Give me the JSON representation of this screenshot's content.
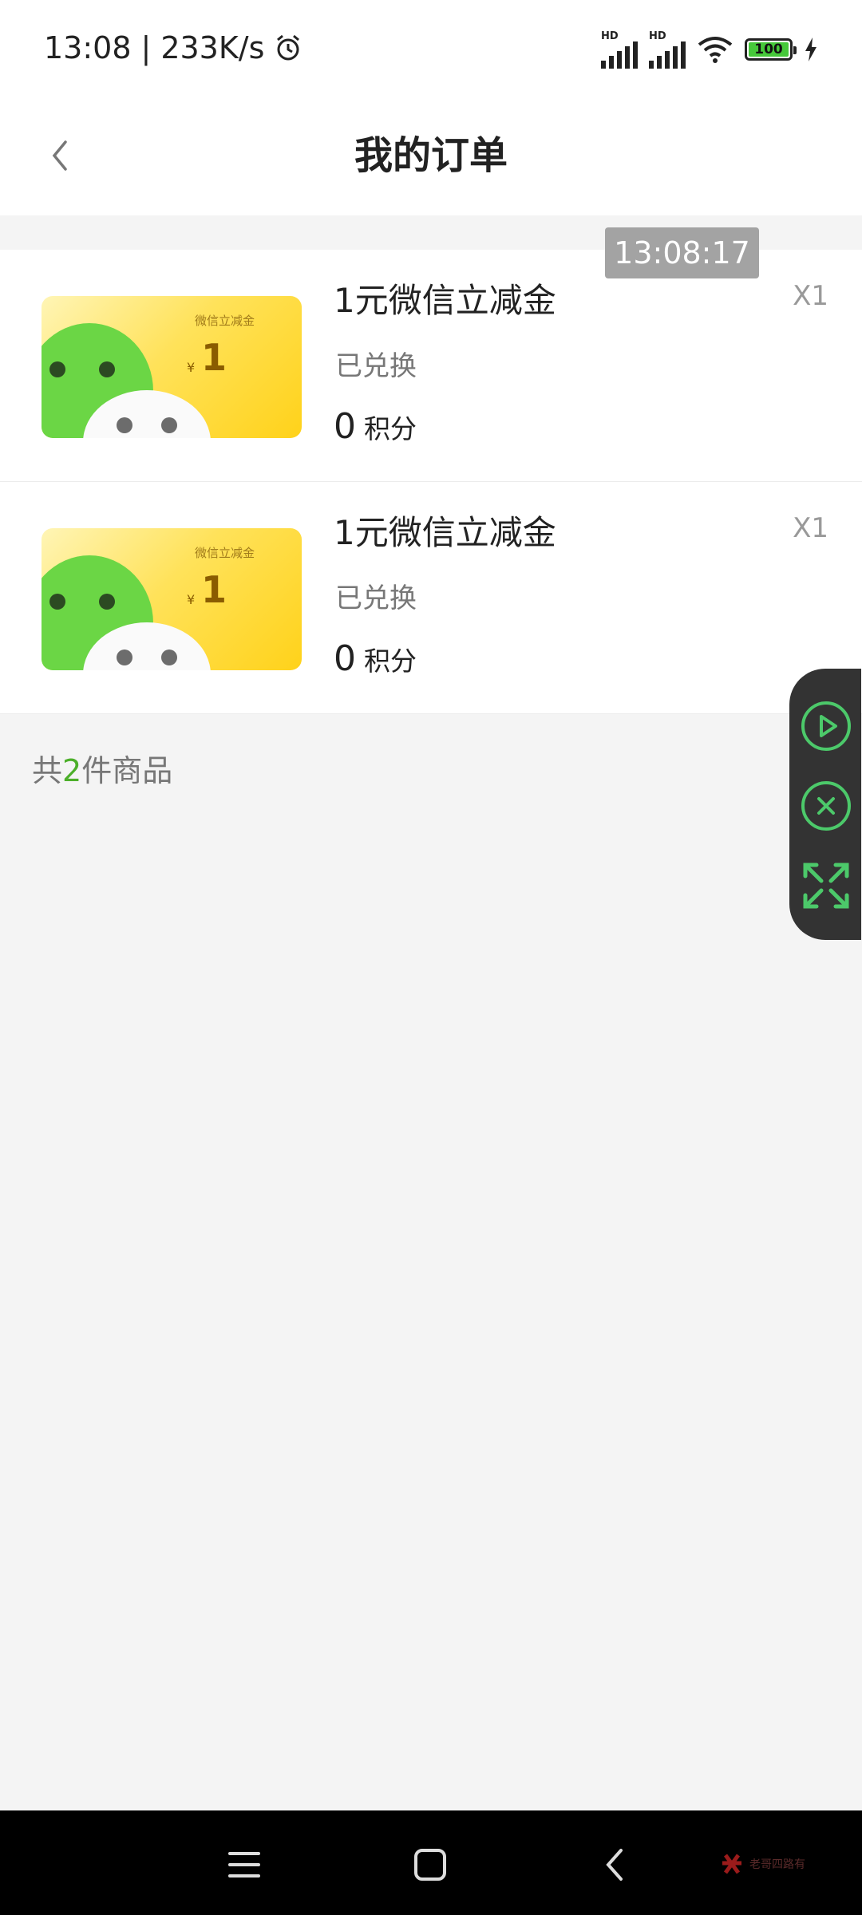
{
  "status_bar": {
    "time": "13:08",
    "speed": "233K/s",
    "hd_label": "HD",
    "battery": "100"
  },
  "header": {
    "title": "我的订单"
  },
  "time_badge": "13:08:17",
  "orders": [
    {
      "name": "1元微信立减金",
      "status": "已兑换",
      "points": "0",
      "points_unit": "积分",
      "qty": "X1",
      "card_label": "微信立减金",
      "card_yen": "¥",
      "card_value": "1"
    },
    {
      "name": "1元微信立减金",
      "status": "已兑换",
      "points": "0",
      "points_unit": "积分",
      "qty": "X1",
      "card_label": "微信立减金",
      "card_yen": "¥",
      "card_value": "1"
    }
  ],
  "summary": {
    "prefix": "共",
    "count": "2",
    "suffix": "件商品"
  },
  "watermark": {
    "text": "老哥四路有"
  },
  "colors": {
    "accent_green": "#4caf2a",
    "float_icon_green": "#4cc96a",
    "float_bg": "#333333",
    "card_yellow": "#ffd21a"
  },
  "icons": {
    "back": "chevron-left-icon",
    "alarm": "alarm-icon",
    "wifi": "wifi-icon",
    "play": "play-circle-icon",
    "close": "close-circle-icon",
    "expand": "expand-icon",
    "menu": "menu-icon",
    "home": "home-square-icon",
    "nav_back": "nav-back-icon"
  }
}
